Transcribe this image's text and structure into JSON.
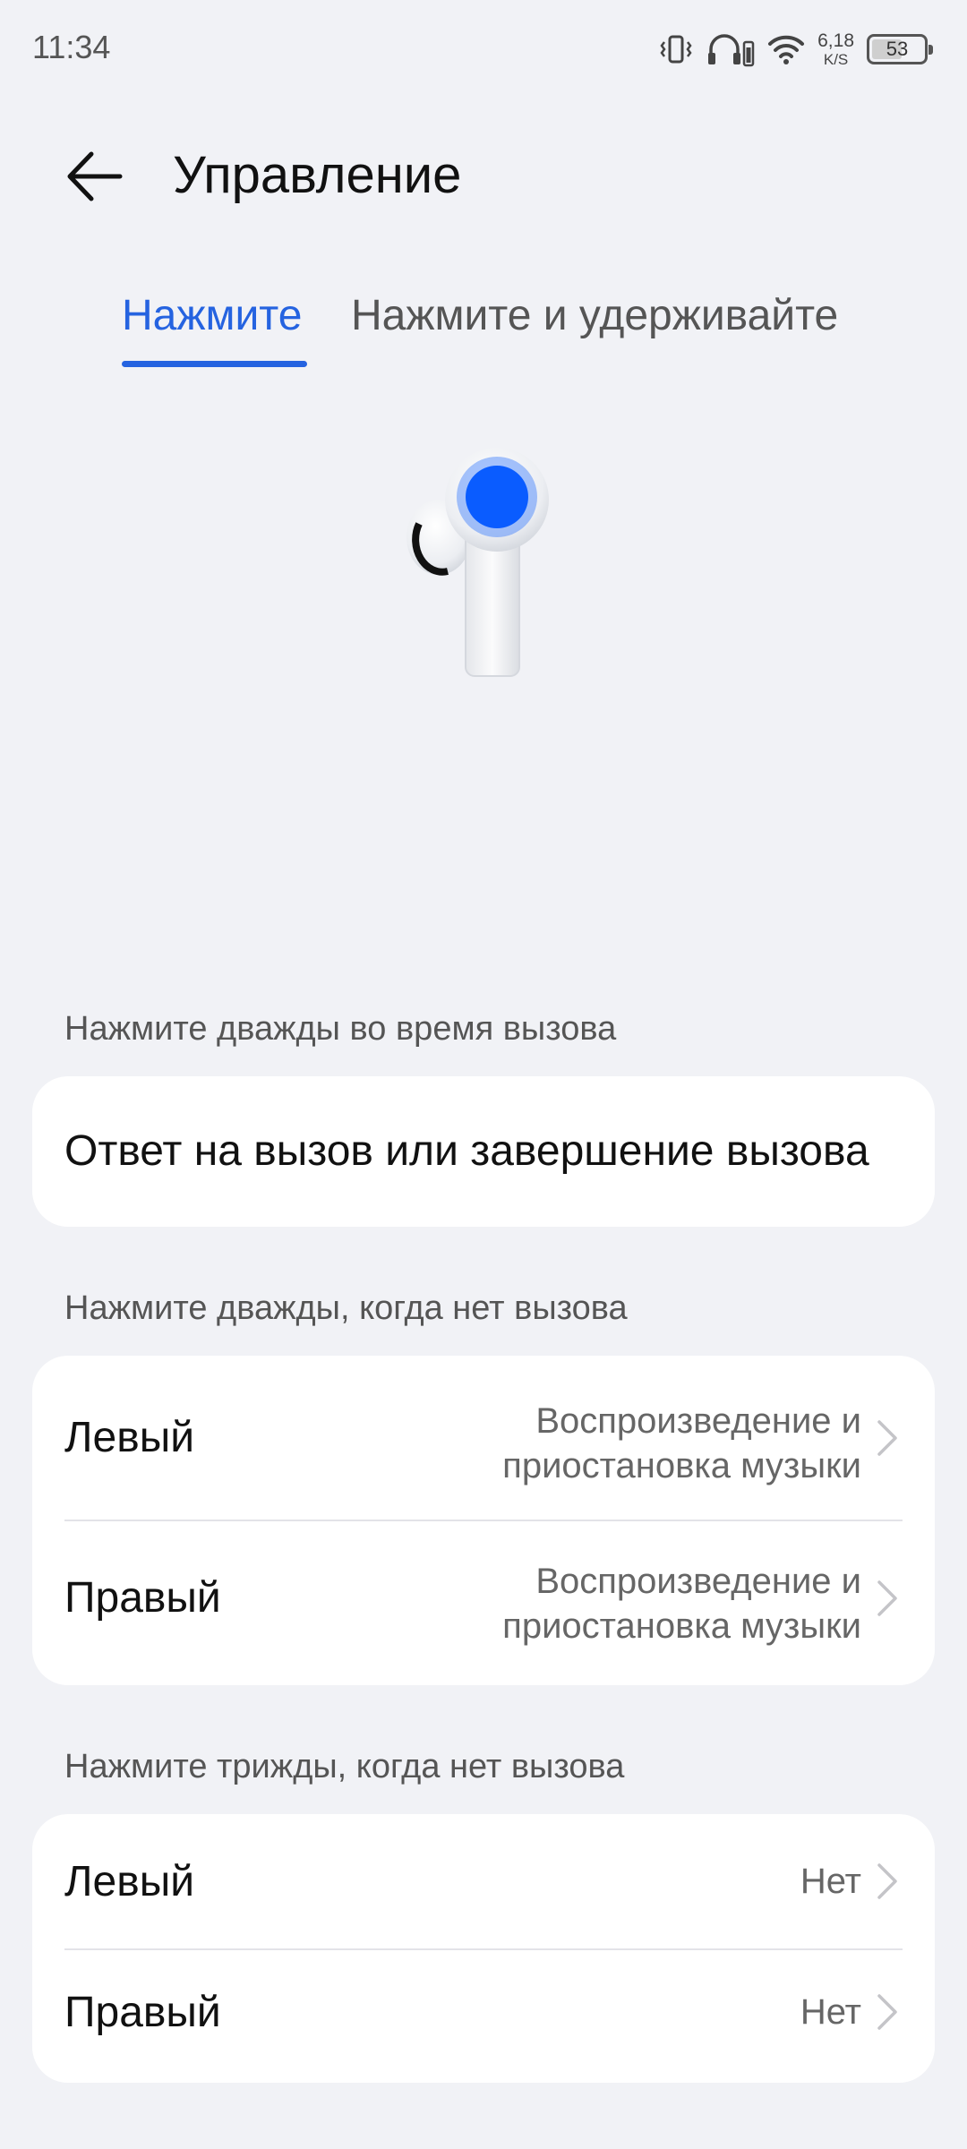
{
  "status_bar": {
    "time": "11:34",
    "net_speed_value": "6,18",
    "net_speed_unit": "K/S",
    "battery_level": "53",
    "icons": [
      "vibrate-icon",
      "headphones-battery-icon",
      "wifi-icon",
      "net-speed",
      "battery-icon"
    ]
  },
  "header": {
    "title": "Управление",
    "back_icon": "arrow-left-icon"
  },
  "tabs": [
    {
      "label": "Нажмите",
      "selected": true
    },
    {
      "label": "Нажмите и удерживайте",
      "selected": false
    }
  ],
  "sections": {
    "double_call": {
      "label": "Нажмите дважды во время вызова",
      "rows": [
        {
          "title": "Ответ на вызов или завершение вызова"
        }
      ]
    },
    "double_no_call": {
      "label": "Нажмите дважды, когда нет вызова",
      "rows": [
        {
          "title": "Левый",
          "value_line1": "Воспроизведение и",
          "value_line2": "приостановка музыки"
        },
        {
          "title": "Правый",
          "value_line1": "Воспроизведение и",
          "value_line2": "приостановка музыки"
        }
      ]
    },
    "triple_no_call": {
      "label": "Нажмите трижды, когда нет вызова",
      "rows": [
        {
          "title": "Левый",
          "value": "Нет"
        },
        {
          "title": "Правый",
          "value": "Нет"
        }
      ]
    }
  },
  "colors": {
    "accent": "#2563e0",
    "background": "#f1f2f6",
    "card": "#ffffff",
    "tap_indicator": "#0a5cff"
  }
}
